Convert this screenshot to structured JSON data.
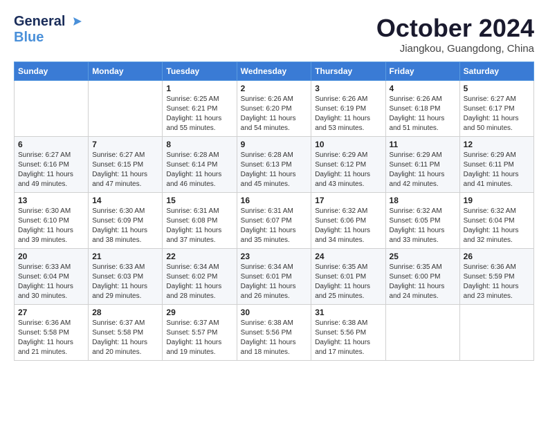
{
  "header": {
    "logo_line1": "General",
    "logo_line2": "Blue",
    "month": "October 2024",
    "location": "Jiangkou, Guangdong, China"
  },
  "weekdays": [
    "Sunday",
    "Monday",
    "Tuesday",
    "Wednesday",
    "Thursday",
    "Friday",
    "Saturday"
  ],
  "weeks": [
    [
      {
        "day": "",
        "content": ""
      },
      {
        "day": "",
        "content": ""
      },
      {
        "day": "1",
        "content": "Sunrise: 6:25 AM\nSunset: 6:21 PM\nDaylight: 11 hours and 55 minutes."
      },
      {
        "day": "2",
        "content": "Sunrise: 6:26 AM\nSunset: 6:20 PM\nDaylight: 11 hours and 54 minutes."
      },
      {
        "day": "3",
        "content": "Sunrise: 6:26 AM\nSunset: 6:19 PM\nDaylight: 11 hours and 53 minutes."
      },
      {
        "day": "4",
        "content": "Sunrise: 6:26 AM\nSunset: 6:18 PM\nDaylight: 11 hours and 51 minutes."
      },
      {
        "day": "5",
        "content": "Sunrise: 6:27 AM\nSunset: 6:17 PM\nDaylight: 11 hours and 50 minutes."
      }
    ],
    [
      {
        "day": "6",
        "content": "Sunrise: 6:27 AM\nSunset: 6:16 PM\nDaylight: 11 hours and 49 minutes."
      },
      {
        "day": "7",
        "content": "Sunrise: 6:27 AM\nSunset: 6:15 PM\nDaylight: 11 hours and 47 minutes."
      },
      {
        "day": "8",
        "content": "Sunrise: 6:28 AM\nSunset: 6:14 PM\nDaylight: 11 hours and 46 minutes."
      },
      {
        "day": "9",
        "content": "Sunrise: 6:28 AM\nSunset: 6:13 PM\nDaylight: 11 hours and 45 minutes."
      },
      {
        "day": "10",
        "content": "Sunrise: 6:29 AM\nSunset: 6:12 PM\nDaylight: 11 hours and 43 minutes."
      },
      {
        "day": "11",
        "content": "Sunrise: 6:29 AM\nSunset: 6:11 PM\nDaylight: 11 hours and 42 minutes."
      },
      {
        "day": "12",
        "content": "Sunrise: 6:29 AM\nSunset: 6:11 PM\nDaylight: 11 hours and 41 minutes."
      }
    ],
    [
      {
        "day": "13",
        "content": "Sunrise: 6:30 AM\nSunset: 6:10 PM\nDaylight: 11 hours and 39 minutes."
      },
      {
        "day": "14",
        "content": "Sunrise: 6:30 AM\nSunset: 6:09 PM\nDaylight: 11 hours and 38 minutes."
      },
      {
        "day": "15",
        "content": "Sunrise: 6:31 AM\nSunset: 6:08 PM\nDaylight: 11 hours and 37 minutes."
      },
      {
        "day": "16",
        "content": "Sunrise: 6:31 AM\nSunset: 6:07 PM\nDaylight: 11 hours and 35 minutes."
      },
      {
        "day": "17",
        "content": "Sunrise: 6:32 AM\nSunset: 6:06 PM\nDaylight: 11 hours and 34 minutes."
      },
      {
        "day": "18",
        "content": "Sunrise: 6:32 AM\nSunset: 6:05 PM\nDaylight: 11 hours and 33 minutes."
      },
      {
        "day": "19",
        "content": "Sunrise: 6:32 AM\nSunset: 6:04 PM\nDaylight: 11 hours and 32 minutes."
      }
    ],
    [
      {
        "day": "20",
        "content": "Sunrise: 6:33 AM\nSunset: 6:04 PM\nDaylight: 11 hours and 30 minutes."
      },
      {
        "day": "21",
        "content": "Sunrise: 6:33 AM\nSunset: 6:03 PM\nDaylight: 11 hours and 29 minutes."
      },
      {
        "day": "22",
        "content": "Sunrise: 6:34 AM\nSunset: 6:02 PM\nDaylight: 11 hours and 28 minutes."
      },
      {
        "day": "23",
        "content": "Sunrise: 6:34 AM\nSunset: 6:01 PM\nDaylight: 11 hours and 26 minutes."
      },
      {
        "day": "24",
        "content": "Sunrise: 6:35 AM\nSunset: 6:01 PM\nDaylight: 11 hours and 25 minutes."
      },
      {
        "day": "25",
        "content": "Sunrise: 6:35 AM\nSunset: 6:00 PM\nDaylight: 11 hours and 24 minutes."
      },
      {
        "day": "26",
        "content": "Sunrise: 6:36 AM\nSunset: 5:59 PM\nDaylight: 11 hours and 23 minutes."
      }
    ],
    [
      {
        "day": "27",
        "content": "Sunrise: 6:36 AM\nSunset: 5:58 PM\nDaylight: 11 hours and 21 minutes."
      },
      {
        "day": "28",
        "content": "Sunrise: 6:37 AM\nSunset: 5:58 PM\nDaylight: 11 hours and 20 minutes."
      },
      {
        "day": "29",
        "content": "Sunrise: 6:37 AM\nSunset: 5:57 PM\nDaylight: 11 hours and 19 minutes."
      },
      {
        "day": "30",
        "content": "Sunrise: 6:38 AM\nSunset: 5:56 PM\nDaylight: 11 hours and 18 minutes."
      },
      {
        "day": "31",
        "content": "Sunrise: 6:38 AM\nSunset: 5:56 PM\nDaylight: 11 hours and 17 minutes."
      },
      {
        "day": "",
        "content": ""
      },
      {
        "day": "",
        "content": ""
      }
    ]
  ]
}
